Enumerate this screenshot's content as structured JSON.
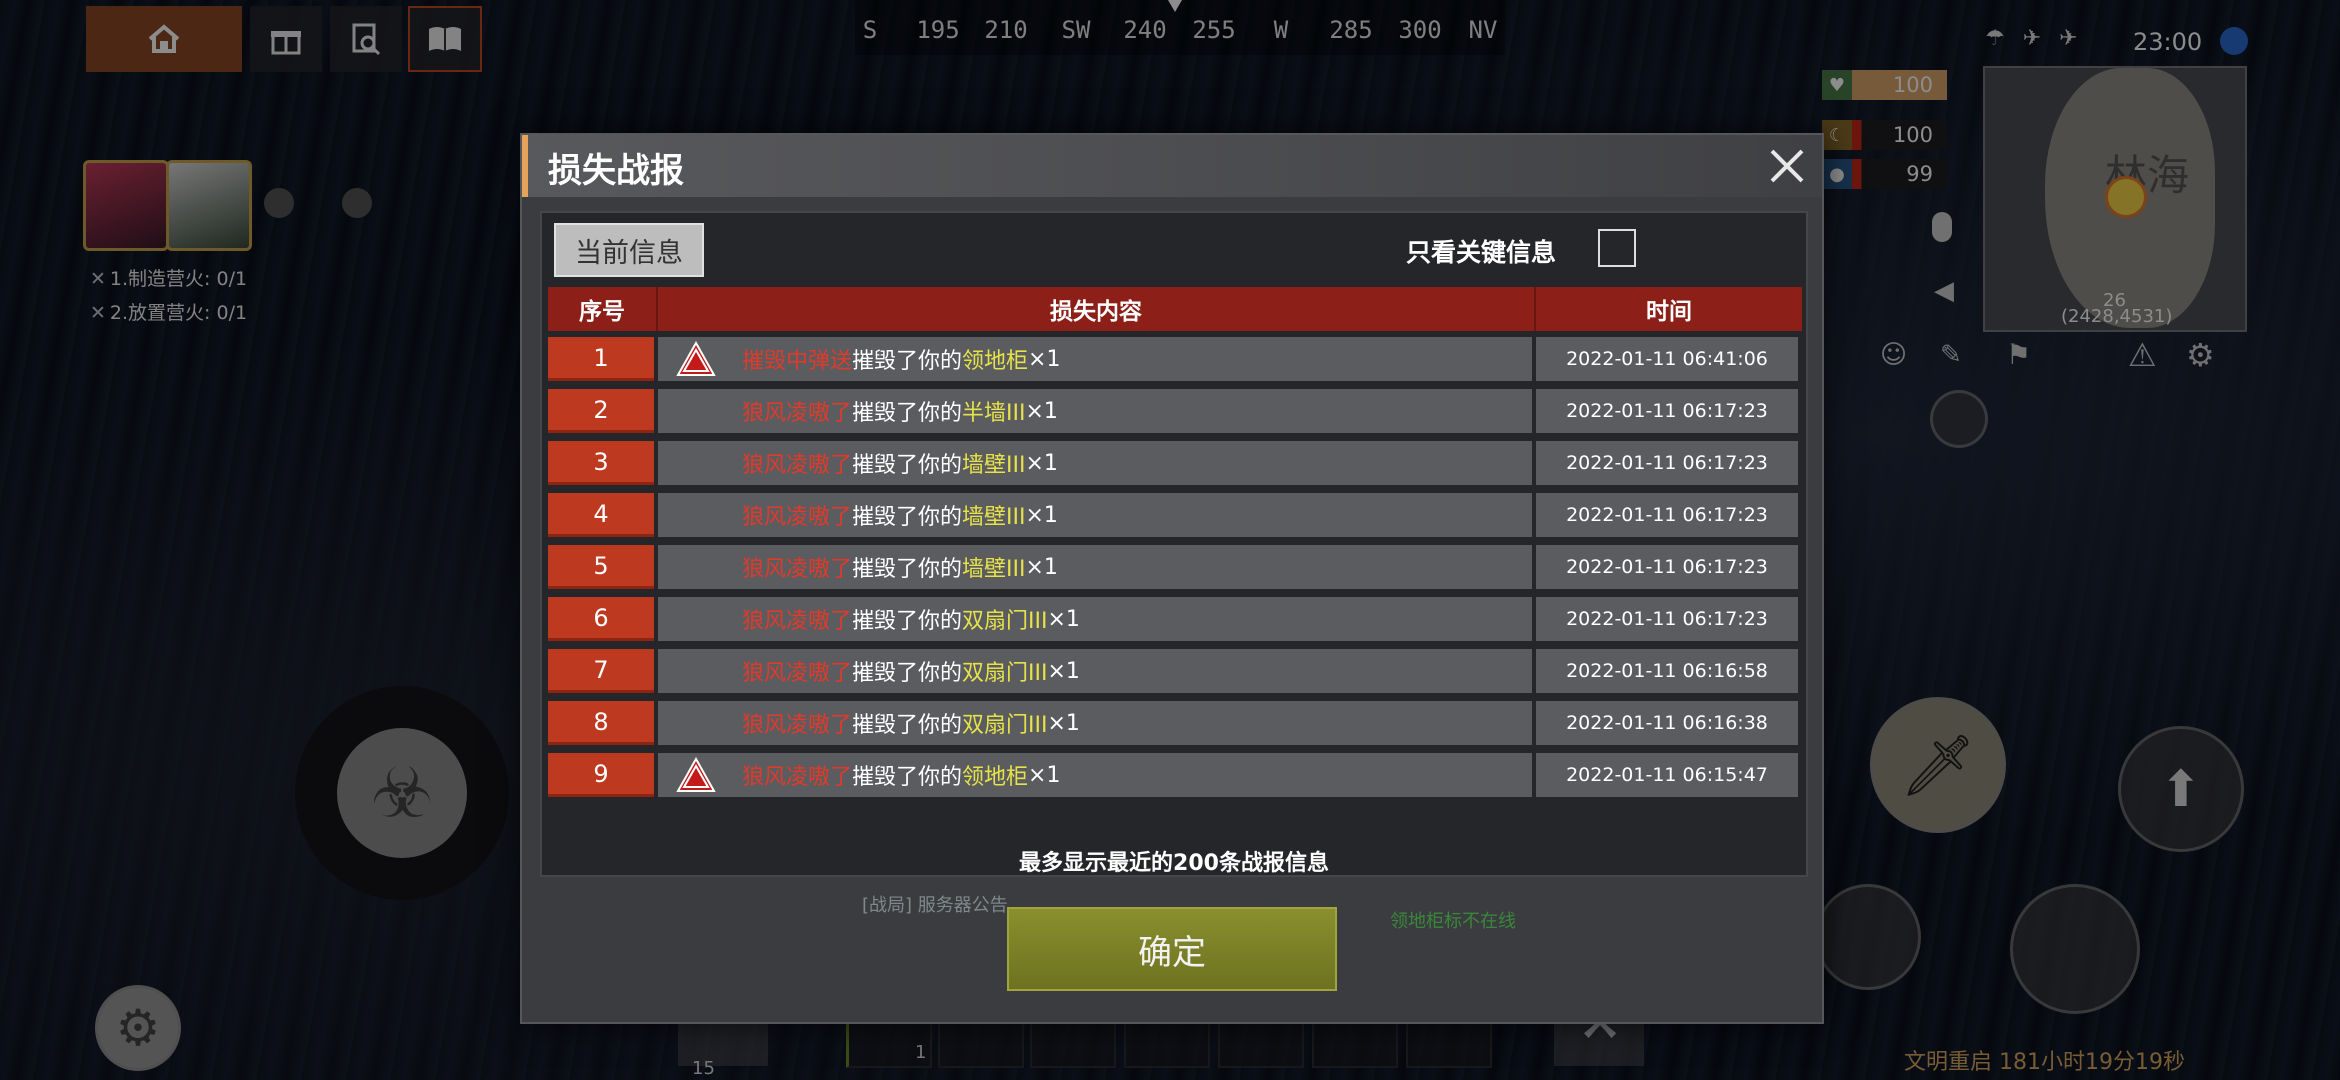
{
  "top_menu": {
    "icons": [
      "home-icon",
      "gift-icon",
      "search-icon",
      "book-icon"
    ]
  },
  "compass": {
    "ticks": [
      "S",
      "195",
      "210",
      "SW",
      "240",
      "255",
      "W",
      "285",
      "300",
      "NV"
    ]
  },
  "quests": [
    {
      "label": "1.制造营火: 0/1"
    },
    {
      "label": "2.放置营火: 0/1"
    }
  ],
  "hud": {
    "clock": "23:00",
    "health": "100",
    "food": "100",
    "water": "99",
    "map_number": "26",
    "coords": "(2428,4531)",
    "map_text": "林海"
  },
  "dialog": {
    "title": "损失战报",
    "tab_current": "当前信息",
    "key_info_label": "只看关键信息",
    "key_info_checked": false,
    "columns": [
      "序号",
      "损失内容",
      "时间"
    ],
    "rows": [
      {
        "idx": "1",
        "actor": "摧毁中弹送",
        "verb": "摧毁了你的",
        "item": "领地柜",
        "count": "×1",
        "time": "2022-01-11 06:41:06",
        "warning": true
      },
      {
        "idx": "2",
        "actor": "狼风凌嗷了",
        "verb": "摧毁了你的",
        "item": "半墙III",
        "count": "×1",
        "time": "2022-01-11 06:17:23",
        "warning": false
      },
      {
        "idx": "3",
        "actor": "狼风凌嗷了",
        "verb": "摧毁了你的",
        "item": "墙壁III",
        "count": "×1",
        "time": "2022-01-11 06:17:23",
        "warning": false
      },
      {
        "idx": "4",
        "actor": "狼风凌嗷了",
        "verb": "摧毁了你的",
        "item": "墙壁III",
        "count": "×1",
        "time": "2022-01-11 06:17:23",
        "warning": false
      },
      {
        "idx": "5",
        "actor": "狼风凌嗷了",
        "verb": "摧毁了你的",
        "item": "墙壁III",
        "count": "×1",
        "time": "2022-01-11 06:17:23",
        "warning": false
      },
      {
        "idx": "6",
        "actor": "狼风凌嗷了",
        "verb": "摧毁了你的",
        "item": "双扇门III",
        "count": "×1",
        "time": "2022-01-11 06:17:23",
        "warning": false
      },
      {
        "idx": "7",
        "actor": "狼风凌嗷了",
        "verb": "摧毁了你的",
        "item": "双扇门III",
        "count": "×1",
        "time": "2022-01-11 06:16:58",
        "warning": false
      },
      {
        "idx": "8",
        "actor": "狼风凌嗷了",
        "verb": "摧毁了你的",
        "item": "双扇门III",
        "count": "×1",
        "time": "2022-01-11 06:16:38",
        "warning": false
      },
      {
        "idx": "9",
        "actor": "狼风凌嗷了",
        "verb": "摧毁了你的",
        "item": "领地柜",
        "count": "×1",
        "time": "2022-01-11 06:15:47",
        "warning": true
      }
    ],
    "footnote": "最多显示最近的200条战报信息",
    "confirm_label": "确定"
  },
  "background_text": {
    "chat": "[战局] 服务器公告 ...",
    "green": "领地柜标不在线"
  },
  "bottom": {
    "slot_count": "15",
    "slot_one": "1",
    "timer": "文明重启 181小时19分19秒"
  },
  "colors": {
    "header_red": "#8c2019",
    "index_red": "#bd3a20",
    "actor_red": "#e03a2a",
    "item_yellow": "#e6e24a",
    "confirm_green": "#7a8026"
  }
}
